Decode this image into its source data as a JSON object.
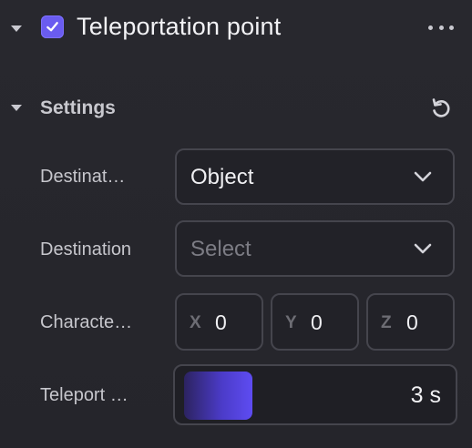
{
  "header": {
    "title": "Teleportation point",
    "enabled": true
  },
  "settings": {
    "title": "Settings",
    "rows": {
      "destination_type": {
        "label": "Destinat…",
        "value": "Object"
      },
      "destination": {
        "label": "Destination",
        "placeholder": "Select"
      },
      "character": {
        "label": "Characte…",
        "x": {
          "axis": "X",
          "value": "0"
        },
        "y": {
          "axis": "Y",
          "value": "0"
        },
        "z": {
          "axis": "Z",
          "value": "0"
        }
      },
      "teleport": {
        "label": "Teleport …",
        "value_text": "3 s",
        "fill_fraction": 0.26
      }
    }
  },
  "icons": {
    "collapse": "caret-down-icon",
    "check": "checkmark-icon",
    "more": "more-horizontal-icon",
    "reset": "reset-icon",
    "dropdown": "chevron-down-icon"
  },
  "colors": {
    "accent": "#6a5cf0",
    "background": "#26262c",
    "border": "#45454d"
  }
}
